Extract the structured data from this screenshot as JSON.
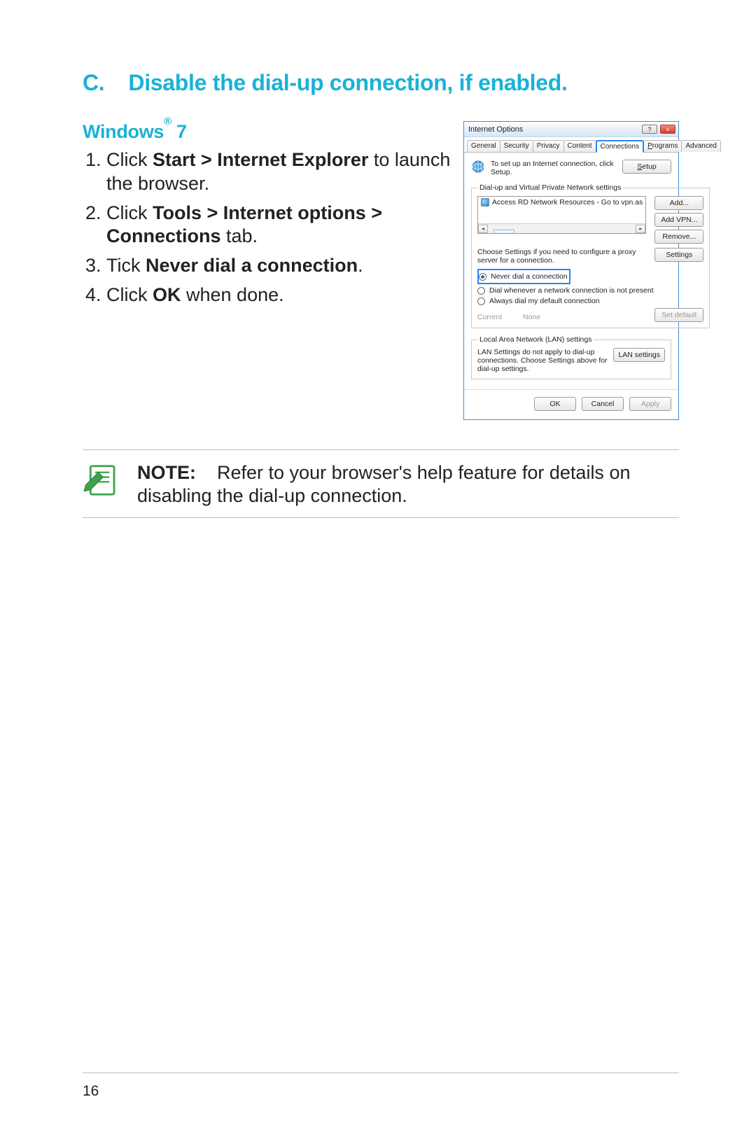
{
  "heading": {
    "letter": "C.",
    "title": "Disable the dial-up connection, if enabled."
  },
  "subhead": {
    "os": "Windows",
    "reg": "®",
    "ver": " 7"
  },
  "steps": {
    "s1a": "Click ",
    "s1b": "Start > Internet Explorer",
    "s1c": " to launch the browser.",
    "s2a": "Click ",
    "s2b": "Tools > Internet options > Connections",
    "s2c": " tab.",
    "s3a": "Tick ",
    "s3b": "Never dial a connection",
    "s3c": ".",
    "s4a": "Click ",
    "s4b": "OK",
    "s4c": " when done."
  },
  "note": {
    "label": "NOTE:",
    "text": " Refer to your browser's help feature for details on disabling the dial-up connection."
  },
  "page_no": "16",
  "dlg": {
    "title": "Internet Options",
    "help": "?",
    "close": "×",
    "tabs": [
      "General",
      "Security",
      "Privacy",
      "Content",
      "Connections",
      "Programs",
      "Advanced"
    ],
    "active_tab_index": 4,
    "setup_text": "To set up an Internet connection, click Setup.",
    "setup_btn": "Setup",
    "vpn_legend": "Dial-up and Virtual Private Network settings",
    "vpn_item": "Access RD Network Resources - Go to vpn.as",
    "add_btn": "Add...",
    "add_vpn_btn": "Add VPN...",
    "remove_btn": "Remove...",
    "scroll_left": "◂",
    "scroll_thumb_label": "III",
    "scroll_right": "▸",
    "proxy_text": "Choose Settings if you need to configure a proxy server for a connection.",
    "settings_btn": "Settings",
    "r1": "Never dial a connection",
    "r2": "Dial whenever a network connection is not present",
    "r3": "Always dial my default connection",
    "current_label": "Current",
    "current_value": "None",
    "set_default_btn": "Set default",
    "lan_legend": "Local Area Network (LAN) settings",
    "lan_text": "LAN Settings do not apply to dial-up connections. Choose Settings above for dial-up settings.",
    "lan_btn": "LAN settings",
    "ok": "OK",
    "cancel": "Cancel",
    "apply": "Apply"
  }
}
